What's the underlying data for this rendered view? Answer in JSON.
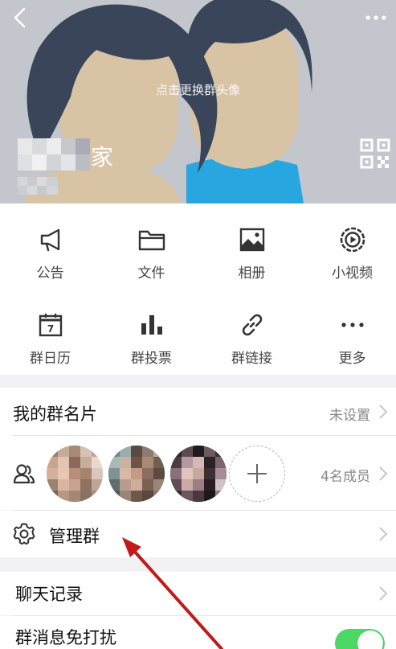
{
  "header": {
    "hint": "点击更换群头像",
    "group_name_visible": "家"
  },
  "actions": [
    {
      "label": "公告",
      "icon": "megaphone-icon"
    },
    {
      "label": "文件",
      "icon": "folder-icon"
    },
    {
      "label": "相册",
      "icon": "photo-album-icon"
    },
    {
      "label": "小视频",
      "icon": "video-icon"
    },
    {
      "label": "群日历",
      "icon": "calendar-icon"
    },
    {
      "label": "群投票",
      "icon": "bar-chart-icon"
    },
    {
      "label": "群链接",
      "icon": "link-icon"
    },
    {
      "label": "更多",
      "icon": "more-dots-icon"
    }
  ],
  "calendar_day": "7",
  "group_card": {
    "title": "我的群名片",
    "value": "未设置"
  },
  "members": {
    "count_text": "4名成员"
  },
  "manage": {
    "title": "管理群"
  },
  "chat_history": {
    "title": "聊天记录"
  },
  "do_not_disturb": {
    "title": "群消息免打扰",
    "enabled": true
  },
  "colors": {
    "toggle_on": "#4cd864",
    "arrow": "#c21a1a",
    "header_bg": "#c3c6cc"
  }
}
